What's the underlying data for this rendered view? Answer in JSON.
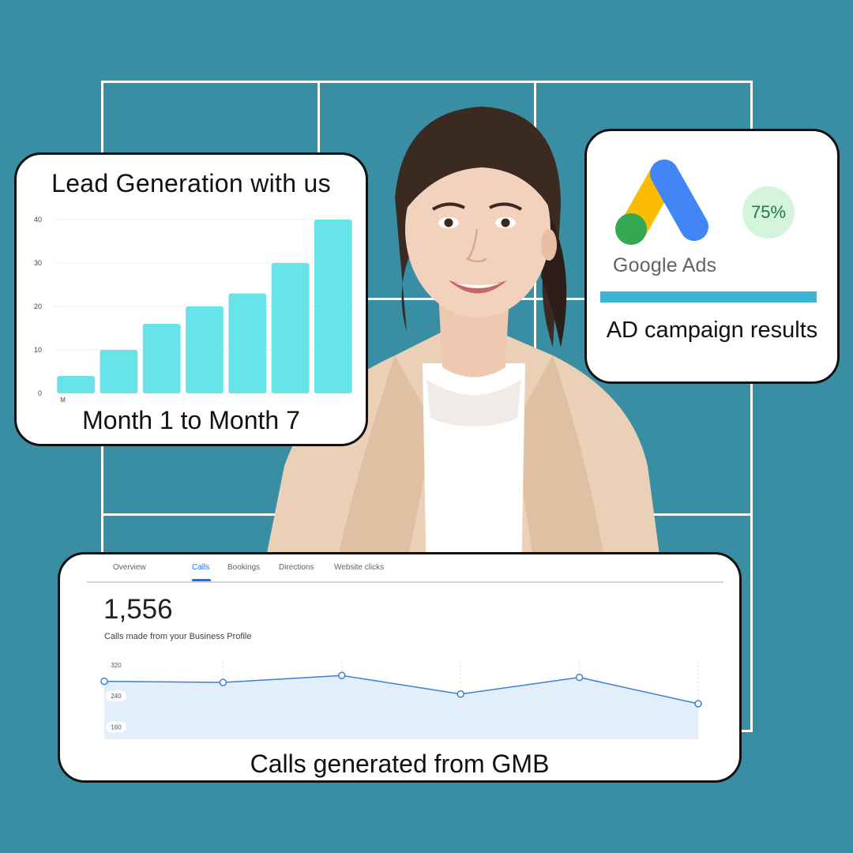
{
  "lead_card": {
    "title": "Lead Generation with us",
    "caption": "Month 1 to Month 7"
  },
  "ads_card": {
    "wordmark": "Google Ads",
    "badge": "75%",
    "progress": 0.75,
    "caption": "AD campaign results",
    "colors": {
      "yellow": "#fbbc04",
      "blue": "#4285f4",
      "green": "#34a853",
      "bar": "#3db5d2"
    }
  },
  "gmb_card": {
    "tabs": [
      "Overview",
      "Calls",
      "Bookings",
      "Directions",
      "Website clicks"
    ],
    "active_tab": "Calls",
    "total": "1,556",
    "subtitle": "Calls made from your Business Profile",
    "caption": "Calls generated from GMB"
  },
  "chart_data": [
    {
      "type": "bar",
      "title": "Lead Generation with us",
      "categories": [
        "M",
        "",
        "",
        "",
        "",
        "",
        ""
      ],
      "values": [
        4,
        10,
        16,
        20,
        23,
        30,
        40
      ],
      "ylim": [
        0,
        40
      ],
      "yticks": [
        "0",
        "10",
        "20",
        "30",
        "40"
      ],
      "grid": true,
      "color": "#68e3e8"
    },
    {
      "type": "area",
      "title": "",
      "values": [
        278,
        275,
        293,
        245,
        288,
        220
      ],
      "ylim": [
        160,
        320
      ],
      "yticks": [
        "320",
        "240",
        "160"
      ],
      "grid": false,
      "color": "#3b7fd6",
      "fill": "#e3eefb"
    }
  ]
}
